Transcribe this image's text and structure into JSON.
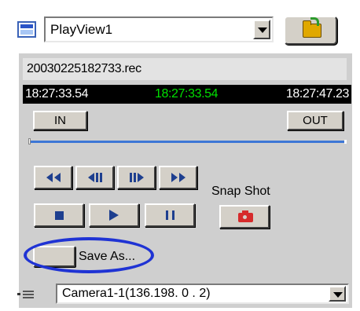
{
  "window": {
    "view_select": {
      "value": "PlayView1"
    }
  },
  "file": {
    "name": "20030225182733.rec"
  },
  "times": {
    "start": "18:27:33.54",
    "current": "18:27:33.54",
    "end": "18:27:47.23",
    "current_color": "#00e000"
  },
  "marks": {
    "in_label": "IN",
    "out_label": "OUT"
  },
  "playback": {
    "progress": 0,
    "accent": "#3d77d6",
    "buttons": [
      "rewind-icon",
      "step-back-icon",
      "step-forward-icon",
      "fast-forward-icon",
      "stop-icon",
      "play-icon",
      "pause-icon"
    ]
  },
  "snapshot": {
    "label": "Snap Shot",
    "icon": "camera-icon"
  },
  "save": {
    "label": "Save As..."
  },
  "highlight": {
    "color": "#1f33d4"
  },
  "camera_select": {
    "value": "Camera1-1(136.198. 0 . 2)"
  }
}
